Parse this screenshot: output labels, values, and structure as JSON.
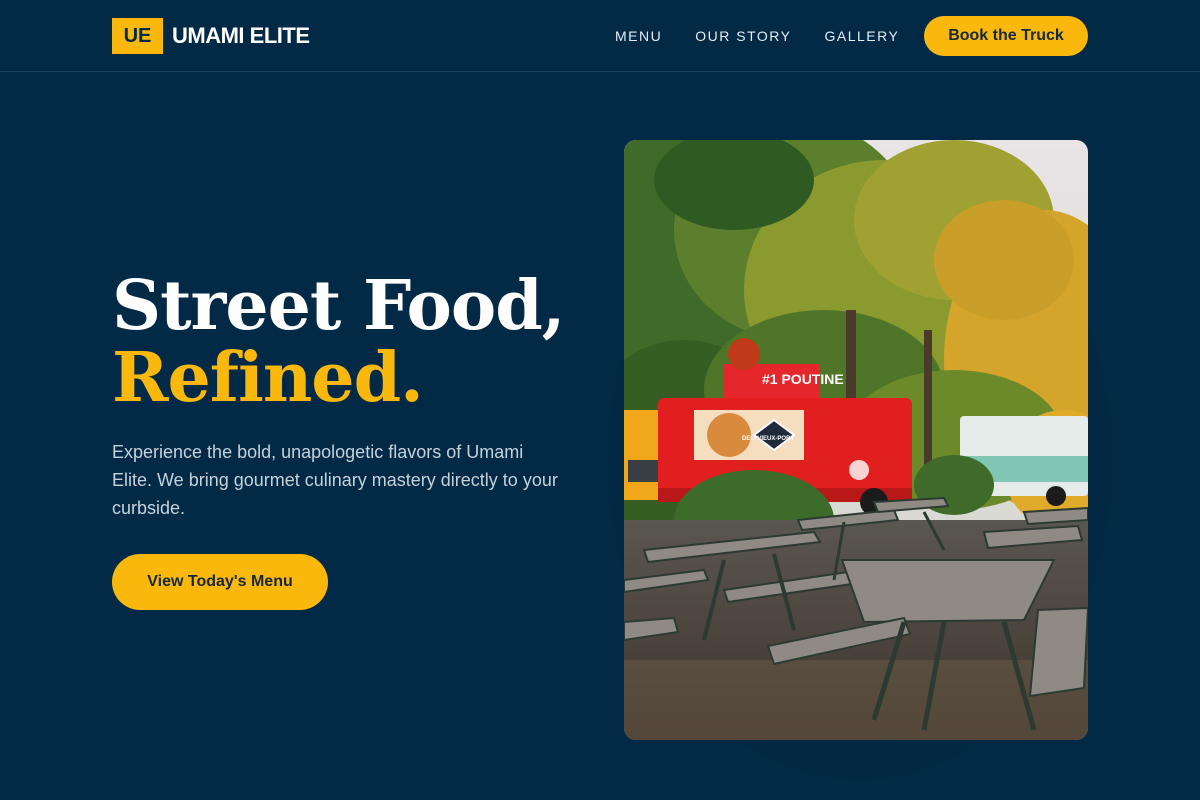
{
  "brand": {
    "mark": "UE",
    "name": "UMAMI ELITE"
  },
  "nav": {
    "items": [
      {
        "label": "MENU"
      },
      {
        "label": "OUR STORY"
      },
      {
        "label": "GALLERY"
      }
    ],
    "cta": "Book the Truck"
  },
  "hero": {
    "title_line1": "Street Food,",
    "title_line2": "Refined.",
    "description": "Experience the bold, unapologetic flavors of Umami Elite. We bring gourmet culinary mastery directly to your curbside.",
    "cta": "View Today's Menu"
  },
  "photo": {
    "truck_sign": "#1 POUTINE",
    "truck_logo": "DELI VIEUX-PORT"
  },
  "colors": {
    "background": "#022945",
    "accent": "#f9b80b",
    "text": "#ffffff",
    "muted": "#c5d2dc"
  }
}
